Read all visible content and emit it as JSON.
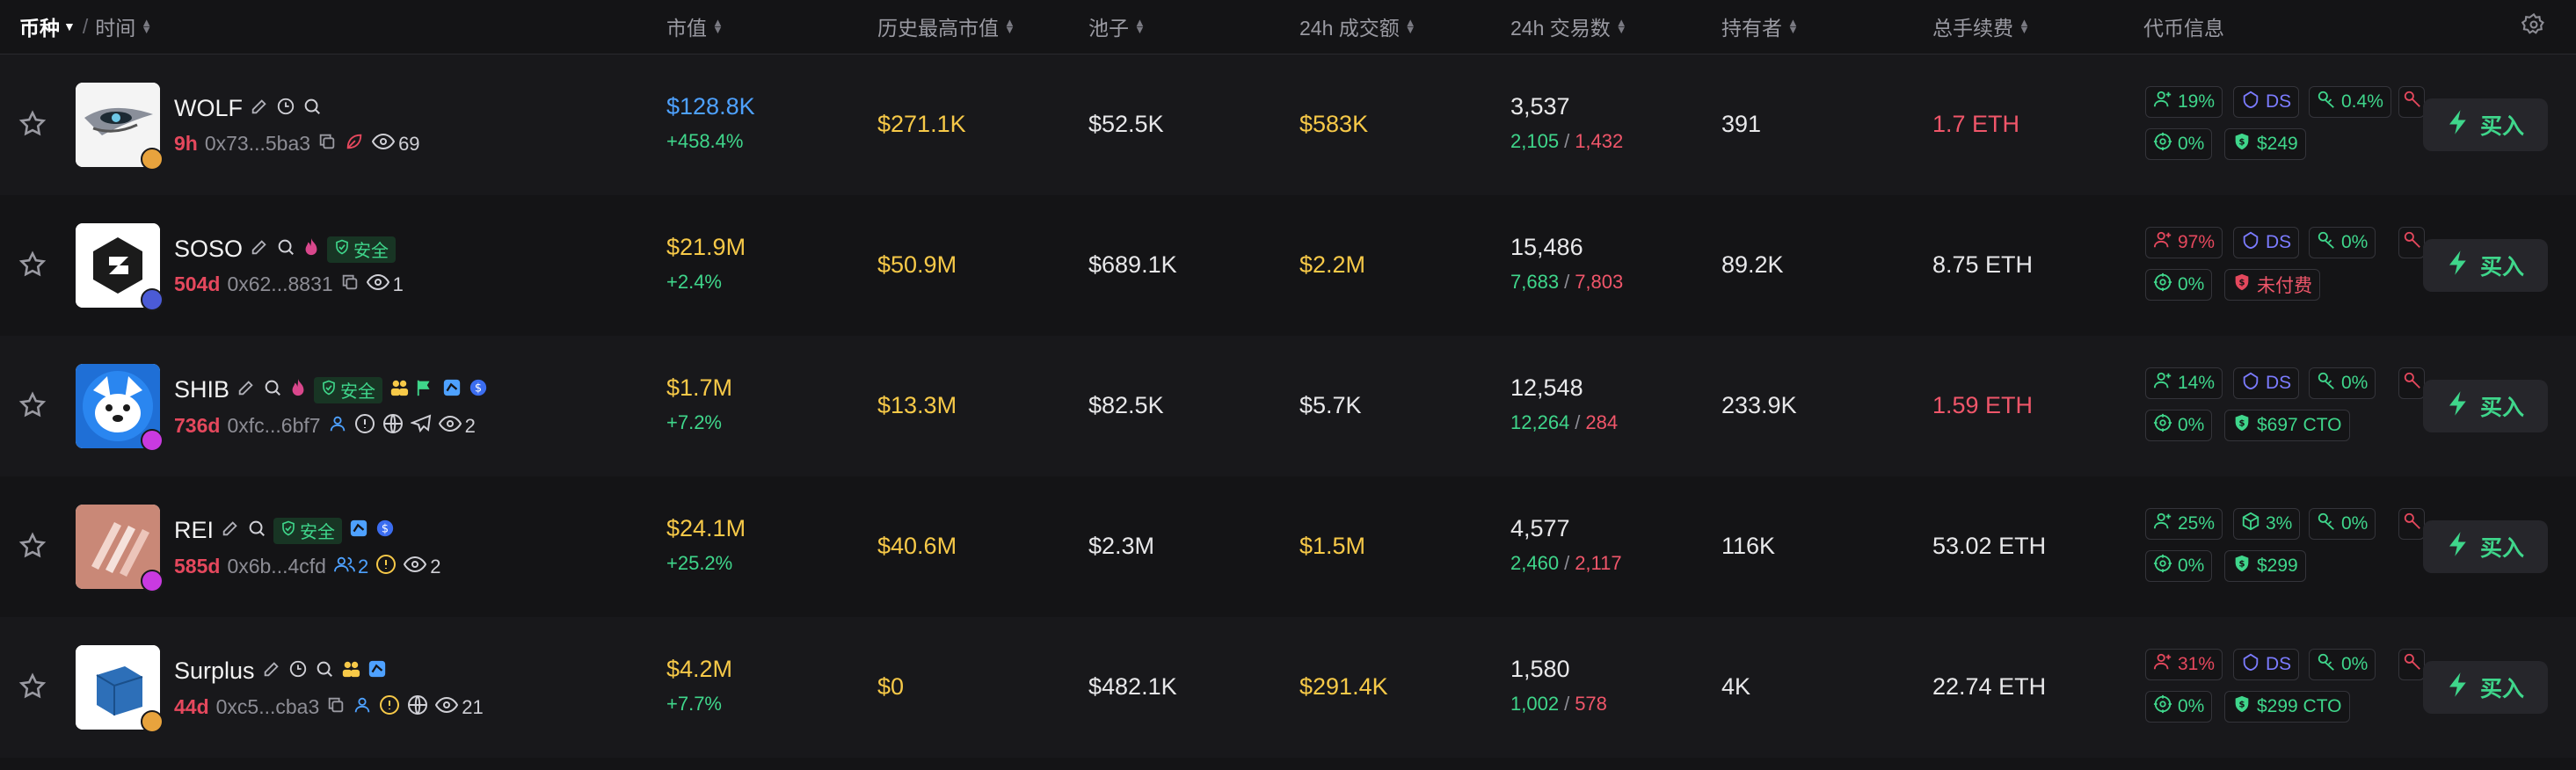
{
  "header": {
    "coin": "币种",
    "sep": "/",
    "time": "时间",
    "market_cap": "市值",
    "ath": "历史最高市值",
    "pool": "池子",
    "volume": "24h 成交额",
    "txns": "24h 交易数",
    "holders": "持有者",
    "fees": "总手续费",
    "token_info": "代币信息"
  },
  "colors": {
    "bg": "#141416",
    "green": "#3fd68b",
    "red": "#f0566a",
    "yellow": "#f7c948",
    "blue": "#4ea1ff"
  },
  "rows": [
    {
      "name": "WOLF",
      "age": "9h",
      "address": "0x73...5ba3",
      "views": "69",
      "market_cap": "$128.8K",
      "mc_change": "+458.4%",
      "ath": "$271.1K",
      "pool": "$52.5K",
      "volume": "$583K",
      "txns": "3,537",
      "buys": "2,105",
      "sells": "1,432",
      "holders": "391",
      "fees": "1.7 ETH",
      "info": {
        "top10": "19%",
        "ds": "DS",
        "insiders": "0.4%",
        "dev": "0%",
        "paid": "$249"
      },
      "buy_label": "买入"
    },
    {
      "name": "SOSO",
      "age": "504d",
      "address": "0x62...8831",
      "views": "1",
      "safe": "安全",
      "market_cap": "$21.9M",
      "mc_change": "+2.4%",
      "ath": "$50.9M",
      "pool": "$689.1K",
      "volume": "$2.2M",
      "txns": "15,486",
      "buys": "7,683",
      "sells": "7,803",
      "holders": "89.2K",
      "fees": "8.75 ETH",
      "info": {
        "top10": "97%",
        "ds": "DS",
        "insiders": "0%",
        "dev": "0%",
        "paid": "未付费"
      },
      "buy_label": "买入"
    },
    {
      "name": "SHIB",
      "age": "736d",
      "address": "0xfc...6bf7",
      "views": "2",
      "safe": "安全",
      "market_cap": "$1.7M",
      "mc_change": "+7.2%",
      "ath": "$13.3M",
      "pool": "$82.5K",
      "volume": "$5.7K",
      "txns": "12,548",
      "buys": "12,264",
      "sells": "284",
      "holders": "233.9K",
      "fees": "1.59 ETH",
      "info": {
        "top10": "14%",
        "ds": "DS",
        "insiders": "0%",
        "dev": "0%",
        "paid": "$697 CTO"
      },
      "buy_label": "买入"
    },
    {
      "name": "REI",
      "age": "585d",
      "address": "0x6b...4cfd",
      "holders_icon_count": "2",
      "views": "2",
      "safe": "安全",
      "market_cap": "$24.1M",
      "mc_change": "+25.2%",
      "ath": "$40.6M",
      "pool": "$2.3M",
      "volume": "$1.5M",
      "txns": "4,577",
      "buys": "2,460",
      "sells": "2,117",
      "holders": "116K",
      "fees": "53.02 ETH",
      "info": {
        "top10": "25%",
        "ds": "3%",
        "insiders": "0%",
        "dev": "0%",
        "paid": "$299"
      },
      "buy_label": "买入"
    },
    {
      "name": "Surplus",
      "age": "44d",
      "address": "0xc5...cba3",
      "views": "21",
      "market_cap": "$4.2M",
      "mc_change": "+7.7%",
      "ath": "$0",
      "pool": "$482.1K",
      "volume": "$291.4K",
      "txns": "1,580",
      "buys": "1,002",
      "sells": "578",
      "holders": "4K",
      "fees": "22.74 ETH",
      "info": {
        "top10": "31%",
        "ds": "DS",
        "insiders": "0%",
        "dev": "0%",
        "paid": "$299 CTO"
      },
      "buy_label": "买入"
    }
  ]
}
